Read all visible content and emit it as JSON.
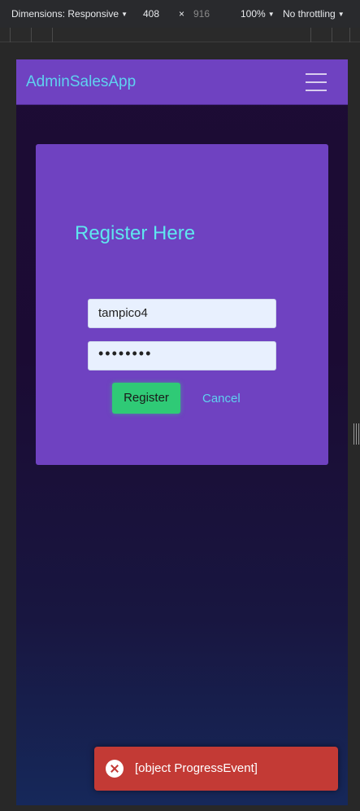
{
  "devtools": {
    "dimensions_label": "Dimensions: Responsive",
    "width": "408",
    "times": "×",
    "height": "916",
    "zoom": "100%",
    "throttling": "No throttling"
  },
  "app": {
    "brand": "AdminSalesApp",
    "colors": {
      "navbar": "#6f42c1",
      "brand_text": "#5fd2f0",
      "title_text": "#5fe7ef",
      "register_button": "#2fca76",
      "toast_bg": "#c33a35"
    }
  },
  "register_form": {
    "title": "Register Here",
    "username_value": "tampico4",
    "password_value": "••••••••",
    "register_label": "Register",
    "cancel_label": "Cancel"
  },
  "toast": {
    "icon": "error-circle-icon",
    "message": "[object ProgressEvent]"
  }
}
